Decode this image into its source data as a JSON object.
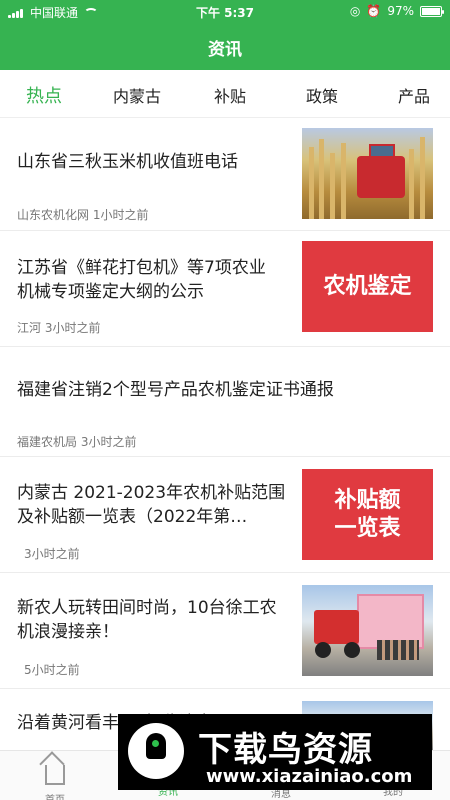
{
  "status": {
    "carrier": "中国联通",
    "time": "下午 5:37",
    "battery": "97%",
    "battery_level": 0.97
  },
  "header": {
    "title": "资讯"
  },
  "tabs": [
    {
      "label": "热点",
      "active": true
    },
    {
      "label": "内蒙古",
      "active": false
    },
    {
      "label": "补贴",
      "active": false
    },
    {
      "label": "政策",
      "active": false
    },
    {
      "label": "产品",
      "active": false
    }
  ],
  "feed": [
    {
      "title": "山东省三秋玉米机收值班电话",
      "source": "山东农机化网",
      "time": "1小时之前",
      "thumbnail": "corn-harvester-photo"
    },
    {
      "title": "江苏省《鲜花打包机》等7项农业机械专项鉴定大纲的公示",
      "source": "江河",
      "time": "3小时之前",
      "thumbnail_text": "农机鉴定"
    },
    {
      "title": "福建省注销2个型号产品农机鉴定证书通报",
      "source": "福建农机局",
      "time": "3小时之前"
    },
    {
      "title": "内蒙古 2021-2023年农机补贴范围及补贴额一览表（2022年第…",
      "source": "",
      "time": "3小时之前",
      "thumbnail_text": "补贴额一览表"
    },
    {
      "title": "新农人玩转田间时尚，10台徐工农机浪漫接亲！",
      "source": "",
      "time": "5小时之前",
      "thumbnail": "tractor-wedding-photo"
    },
    {
      "title": "沿着黄河看丰…“机收达人”…",
      "source": "",
      "time": ""
    }
  ],
  "tabbar": [
    {
      "label": "首页",
      "icon": "home-icon"
    },
    {
      "label": "资讯",
      "icon": "news-icon",
      "active": true
    },
    {
      "label": "消息",
      "icon": "message-icon"
    },
    {
      "label": "我的",
      "icon": "profile-icon"
    }
  ],
  "watermark": {
    "title": "下载鸟资源",
    "url": "www.xiazainiao.com"
  },
  "colors": {
    "brand_green": "#36b351",
    "thumbnail_red": "#e03a40"
  }
}
